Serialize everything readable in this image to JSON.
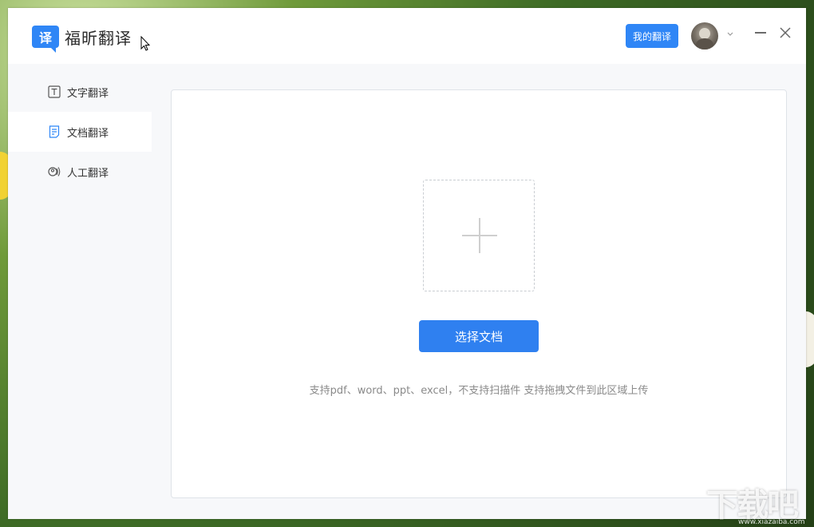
{
  "app": {
    "logo_char": "译",
    "title": "福昕翻译"
  },
  "header": {
    "my_translate_label": "我的翻译"
  },
  "sidebar": {
    "items": [
      {
        "label": "文字翻译",
        "icon": "text-icon"
      },
      {
        "label": "文档翻译",
        "icon": "document-icon"
      },
      {
        "label": "人工翻译",
        "icon": "human-voice-icon"
      }
    ],
    "active_index": 1
  },
  "main": {
    "select_button_label": "选择文档",
    "hint_text": "支持pdf、word、ppt、excel，不支持扫描件 支持拖拽文件到此区域上传"
  },
  "watermark": {
    "logo": "下载吧",
    "url": "www.xiazaiba.com"
  },
  "colors": {
    "accent": "#2f86f6",
    "sidebar_bg": "#f7f8fa"
  }
}
